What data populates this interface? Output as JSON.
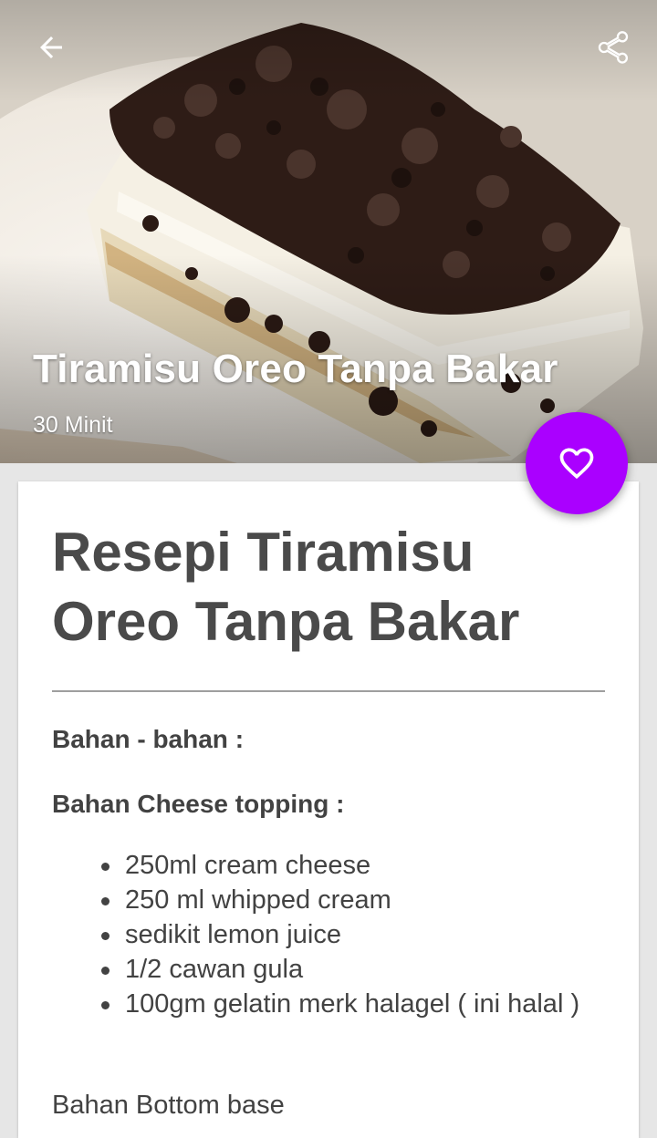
{
  "header": {
    "title": "Tiramisu Oreo Tanpa Bakar",
    "duration": "30 Minit",
    "back_icon": "arrow-left-icon",
    "share_icon": "share-icon",
    "favorite_icon": "heart-outline-icon"
  },
  "colors": {
    "accent": "#aa00ff",
    "text": "#424242"
  },
  "recipe": {
    "title": "Resepi Tiramisu Oreo Tanpa Bakar",
    "ingredients_heading": "Bahan - bahan :",
    "topping_heading": "Bahan Cheese topping :",
    "topping_items": [
      "250ml cream cheese",
      "250 ml whipped cream",
      "sedikit lemon juice",
      "1/2 cawan gula",
      "100gm gelatin merk halagel ( ini halal )"
    ],
    "bottom_base_heading": "Bahan Bottom base"
  }
}
